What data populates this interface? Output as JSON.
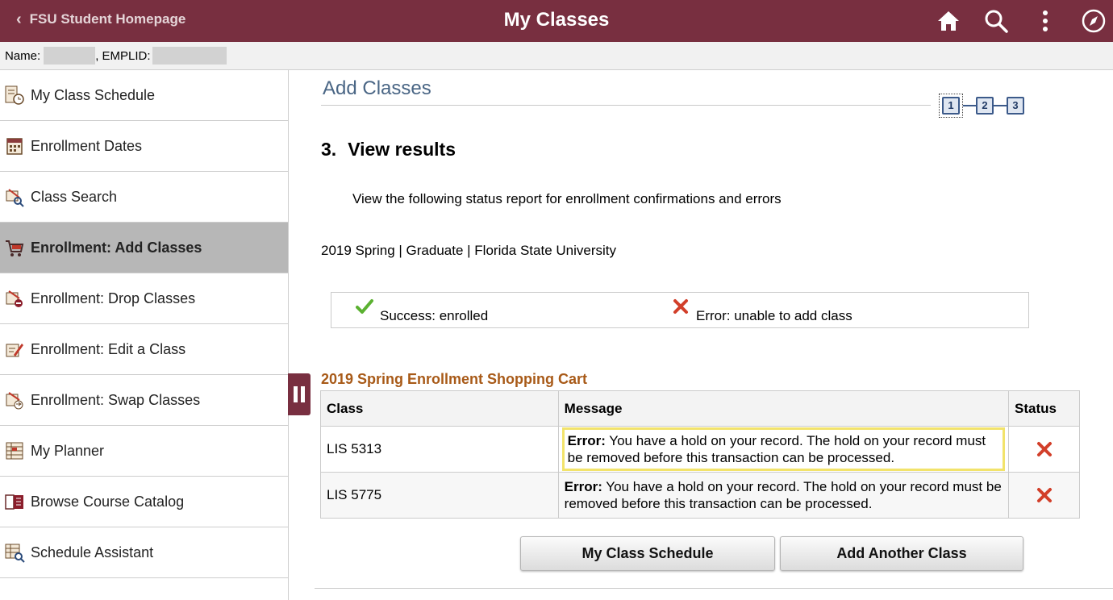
{
  "header": {
    "back_label": "FSU Student Homepage",
    "title": "My Classes",
    "icons": [
      "home-icon",
      "search-icon",
      "more-vertical-icon",
      "navbar-compass-icon"
    ],
    "bg_color": "#782f40"
  },
  "namebar": {
    "name_label": "Name:",
    "emplid_label": ", EMPLID:"
  },
  "sidebar": {
    "items": [
      {
        "label": "My Class Schedule",
        "icon": "schedule-clock-icon"
      },
      {
        "label": "Enrollment Dates",
        "icon": "calendar-icon"
      },
      {
        "label": "Class Search",
        "icon": "class-search-icon"
      },
      {
        "label": "Enrollment:  Add Classes",
        "icon": "cart-icon",
        "active": true
      },
      {
        "label": "Enrollment:  Drop Classes",
        "icon": "drop-class-icon"
      },
      {
        "label": "Enrollment:  Edit a Class",
        "icon": "edit-class-icon"
      },
      {
        "label": "Enrollment:  Swap Classes",
        "icon": "swap-class-icon"
      },
      {
        "label": "My Planner",
        "icon": "planner-icon"
      },
      {
        "label": "Browse Course Catalog",
        "icon": "catalog-book-icon"
      },
      {
        "label": "Schedule Assistant",
        "icon": "schedule-assistant-icon"
      }
    ]
  },
  "main": {
    "title": "Add Classes",
    "steps": [
      "1",
      "2",
      "3"
    ],
    "current_step": 3,
    "step_heading_number": "3.",
    "step_heading": "View results",
    "instructions": "View the following status report for enrollment confirmations and errors",
    "term_info": "2019 Spring | Graduate | Florida State University",
    "legend": {
      "success": "Success: enrolled",
      "error": "Error: unable to add class"
    },
    "cart_title": "2019 Spring Enrollment Shopping Cart",
    "table": {
      "headers": {
        "class": "Class",
        "message": "Message",
        "status": "Status"
      },
      "rows": [
        {
          "class": "LIS 5313",
          "message_prefix": "Error:",
          "message": " You have a hold on your record. The hold on your record must be removed before this transaction can be processed.",
          "status": "error"
        },
        {
          "class": "LIS 5775",
          "message_prefix": "Error:",
          "message": " You have a hold on your record. The hold on your record must be removed before this transaction can be processed.",
          "status": "error"
        }
      ]
    },
    "buttons": {
      "schedule": "My Class Schedule",
      "add_another": "Add Another Class"
    }
  },
  "colors": {
    "success_green": "#5bb131",
    "error_red": "#d23f2a",
    "title_blue": "#4a6685",
    "cart_title_orange": "#a85a18",
    "highlight_yellow": "#f2e36b"
  }
}
